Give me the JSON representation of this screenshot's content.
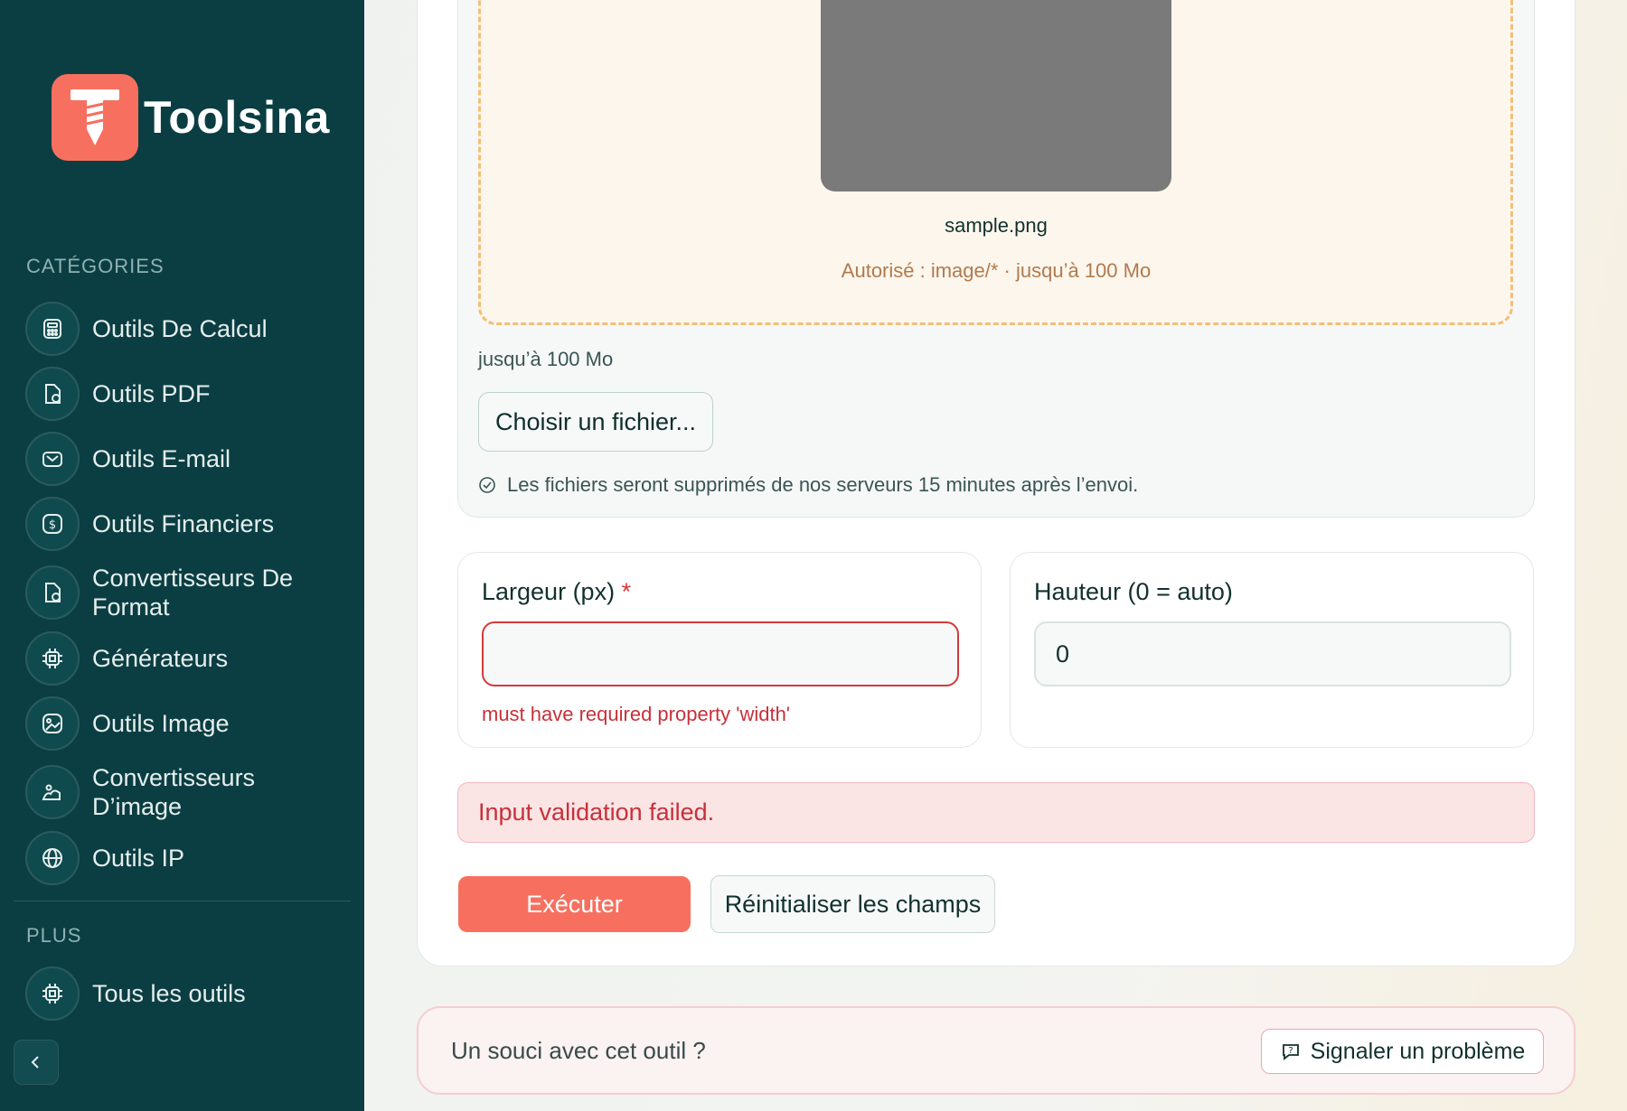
{
  "brand": {
    "name": "Toolsina",
    "color": "#f7705f"
  },
  "sidebar": {
    "categories_label": "CATÉGORIES",
    "items": [
      {
        "label": "Outils De Calcul",
        "icon": "calculator-icon"
      },
      {
        "label": "Outils PDF",
        "icon": "pdf-file-icon"
      },
      {
        "label": "Outils E-mail",
        "icon": "mail-icon"
      },
      {
        "label": "Outils Financiers",
        "icon": "dollar-icon"
      },
      {
        "label": "Convertisseurs De Format",
        "icon": "convert-file-icon"
      },
      {
        "label": "Générateurs",
        "icon": "chip-icon"
      },
      {
        "label": "Outils Image",
        "icon": "image-icon"
      },
      {
        "label": "Convertisseurs D’image",
        "icon": "image-convert-icon"
      },
      {
        "label": "Outils IP",
        "icon": "globe-icon"
      }
    ],
    "more_label": "PLUS",
    "more_items": [
      {
        "label": "Tous les outils",
        "icon": "chip-icon"
      }
    ],
    "collapse_icon": "chevron-left-icon"
  },
  "upload": {
    "filename": "sample.png",
    "allowed": "Autorisé : image/* · jusqu’à 100 Mo",
    "limit": "jusqu’à 100 Mo",
    "choose_button": "Choisir un fichier...",
    "delete_note": "Les fichiers seront supprimés de nos serveurs 15 minutes après l’envoi."
  },
  "fields": {
    "width": {
      "label": "Largeur (px)",
      "required_mark": "*",
      "value": "",
      "error": "must have required property 'width'"
    },
    "height": {
      "label": "Hauteur (0 = auto)",
      "value": "0"
    }
  },
  "error_banner": "Input validation failed.",
  "actions": {
    "run": "Exécuter",
    "reset": "Réinitialiser les champs"
  },
  "report": {
    "text": "Un souci avec cet outil ?",
    "button": "Signaler un problème"
  }
}
